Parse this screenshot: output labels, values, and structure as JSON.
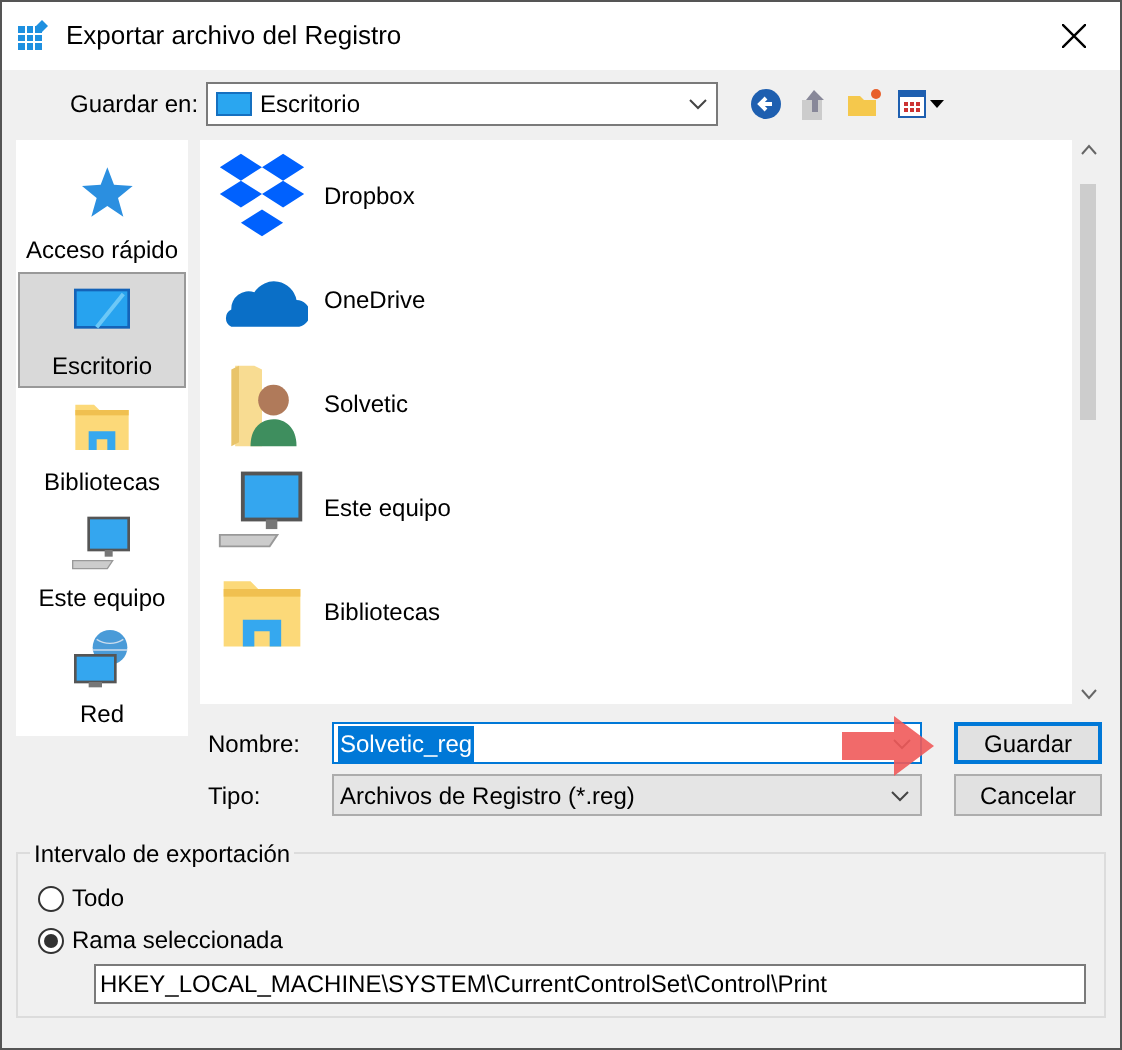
{
  "window": {
    "title": "Exportar archivo del Registro"
  },
  "save_in": {
    "label": "Guardar en:",
    "value": "Escritorio"
  },
  "places": [
    {
      "label": "Acceso rápido",
      "kind": "star",
      "selected": false
    },
    {
      "label": "Escritorio",
      "kind": "desktop",
      "selected": true
    },
    {
      "label": "Bibliotecas",
      "kind": "library",
      "selected": false
    },
    {
      "label": "Este equipo",
      "kind": "computer",
      "selected": false
    },
    {
      "label": "Red",
      "kind": "network",
      "selected": false
    }
  ],
  "files": [
    {
      "name": "Dropbox",
      "kind": "dropbox"
    },
    {
      "name": "OneDrive",
      "kind": "cloud"
    },
    {
      "name": "Solvetic",
      "kind": "user"
    },
    {
      "name": "Este equipo",
      "kind": "computer"
    },
    {
      "name": "Bibliotecas",
      "kind": "library"
    }
  ],
  "filename": {
    "label": "Nombre:",
    "value": "Solvetic_reg"
  },
  "filetype": {
    "label": "Tipo:",
    "value": "Archivos de Registro (*.reg)"
  },
  "buttons": [
    "Guardar",
    "Cancelar"
  ],
  "export_range": {
    "title": "Intervalo de exportación",
    "options": [
      {
        "label": "Todo",
        "selected": false
      },
      {
        "label": "Rama seleccionada",
        "selected": true
      }
    ],
    "branch": "HKEY_LOCAL_MACHINE\\SYSTEM\\CurrentControlSet\\Control\\Print"
  }
}
